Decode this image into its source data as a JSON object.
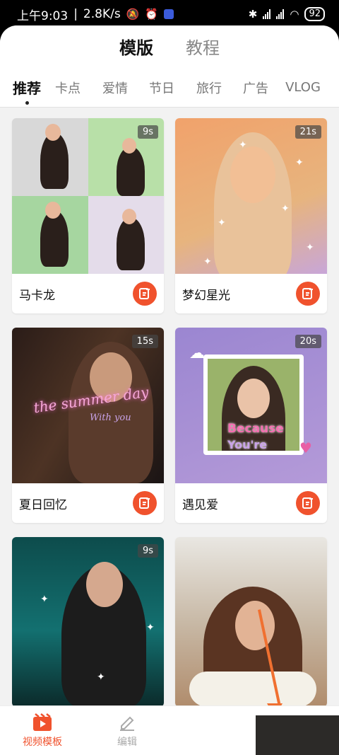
{
  "status_bar": {
    "time": "上午9:03",
    "speed": "2.8K/s",
    "battery": "92"
  },
  "main_tabs": [
    "模版",
    "教程"
  ],
  "category_tabs": [
    "推荐",
    "卡点",
    "爱情",
    "节日",
    "旅行",
    "广告",
    "VLOG"
  ],
  "cards": [
    {
      "title": "马卡龙",
      "duration": "9s"
    },
    {
      "title": "梦幻星光",
      "duration": "21s"
    },
    {
      "title": "夏日回忆",
      "duration": "15s",
      "overlay_text": "the summer day",
      "overlay_sub": "With you"
    },
    {
      "title": "遇见爱",
      "duration": "20s",
      "overlay_text": "Because",
      "overlay_sub": "You're"
    },
    {
      "title": "",
      "duration": "9s"
    },
    {
      "title": "",
      "duration": ""
    }
  ],
  "bottom_nav": [
    {
      "label": "视频模板",
      "icon": "video-template-icon",
      "active": true
    },
    {
      "label": "编辑",
      "icon": "pencil-icon",
      "active": false
    }
  ],
  "colors": {
    "accent": "#f0522d"
  }
}
